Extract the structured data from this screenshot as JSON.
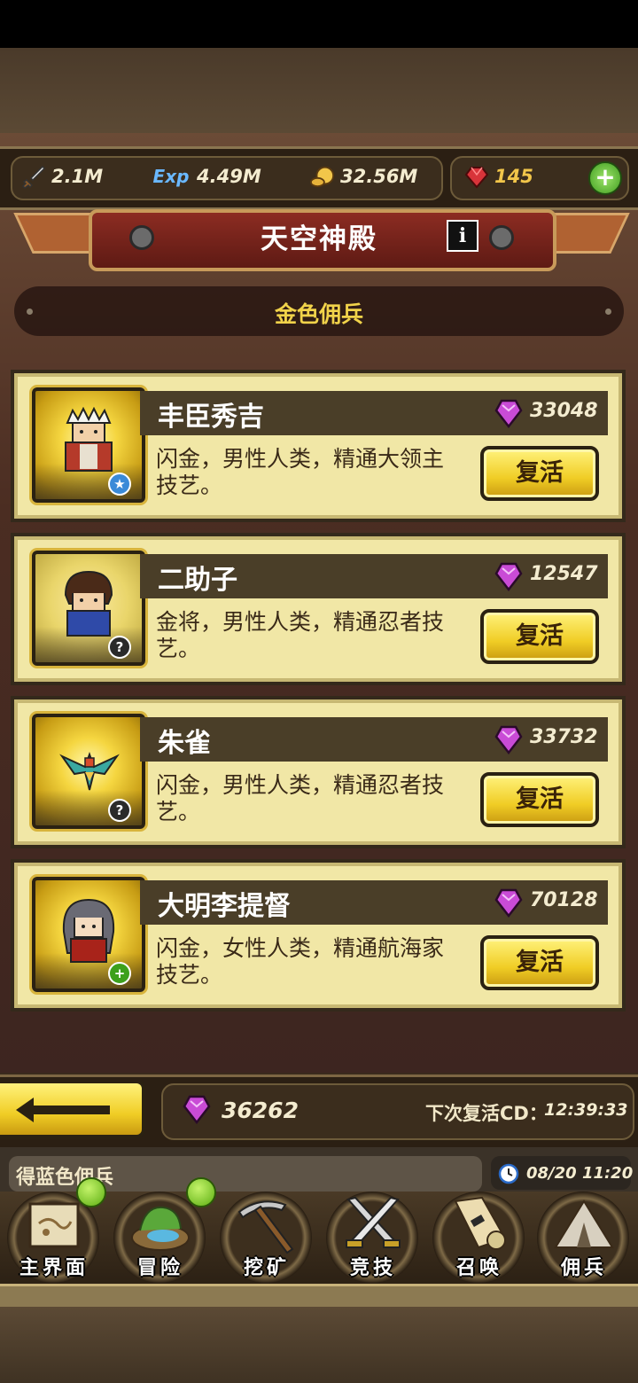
{
  "resources": {
    "attack": "2.1M",
    "exp_icon_label": "Exp",
    "exp": "4.49M",
    "coins": "32.56M",
    "rubies": "145",
    "add_label": "+"
  },
  "header": {
    "title": "天空神殿",
    "info_label": "i"
  },
  "section": {
    "title": "金色佣兵"
  },
  "mercenaries": [
    {
      "name": "丰臣秀吉",
      "price": "33048",
      "desc": "闪金，男性人类，精通大领主技艺。",
      "button": "复活",
      "badge": "★"
    },
    {
      "name": "二助子",
      "price": "12547",
      "desc": "金将，男性人类，精通忍者技艺。",
      "button": "复活",
      "badge": "?"
    },
    {
      "name": "朱雀",
      "price": "33732",
      "desc": "闪金，男性人类，精通忍者技艺。",
      "button": "复活",
      "badge": "?"
    },
    {
      "name": "大明李提督",
      "price": "70128",
      "desc": "闪金，女性人类，精通航海家技艺。",
      "button": "复活",
      "badge": "+"
    }
  ],
  "footer": {
    "total_gems": "36262",
    "cd_label": "下次复活CD：",
    "cd_time": "12:39:33"
  },
  "ticker": {
    "text": "得蓝色佣兵",
    "clock": "08/20 11:20"
  },
  "nav": [
    {
      "label": "主界面",
      "icon": "scroll-map-icon",
      "dot": true
    },
    {
      "label": "冒险",
      "icon": "island-icon",
      "dot": true
    },
    {
      "label": "挖矿",
      "icon": "pickaxe-icon",
      "dot": false
    },
    {
      "label": "竞技",
      "icon": "crossed-swords-icon",
      "dot": false
    },
    {
      "label": "召唤",
      "icon": "summon-scroll-icon",
      "dot": false
    },
    {
      "label": "佣兵",
      "icon": "tent-icon",
      "dot": false
    }
  ],
  "colors": {
    "accent_gold": "#f1d34a",
    "card_bg": "#f1e7a6",
    "banner_red": "#8c2c22",
    "gem_purple": "#c94bd6"
  }
}
